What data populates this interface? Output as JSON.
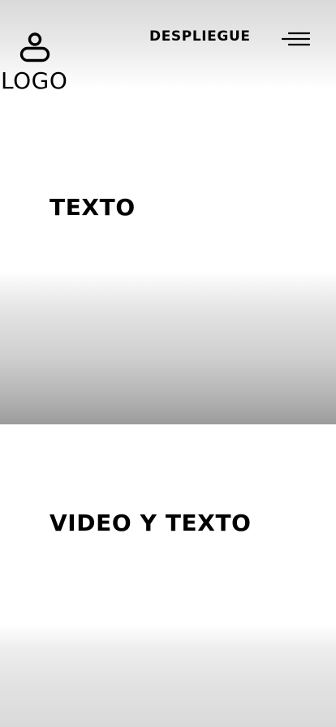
{
  "header": {
    "logo_label": "LOGO",
    "logo_icon": "user-icon",
    "nav_link_label": "DESPLIEGUE",
    "menu_icon": "hamburger-menu-icon"
  },
  "sections": [
    {
      "text": "TEXTO"
    },
    {
      "text": "VIDEO Y TEXTO"
    }
  ]
}
